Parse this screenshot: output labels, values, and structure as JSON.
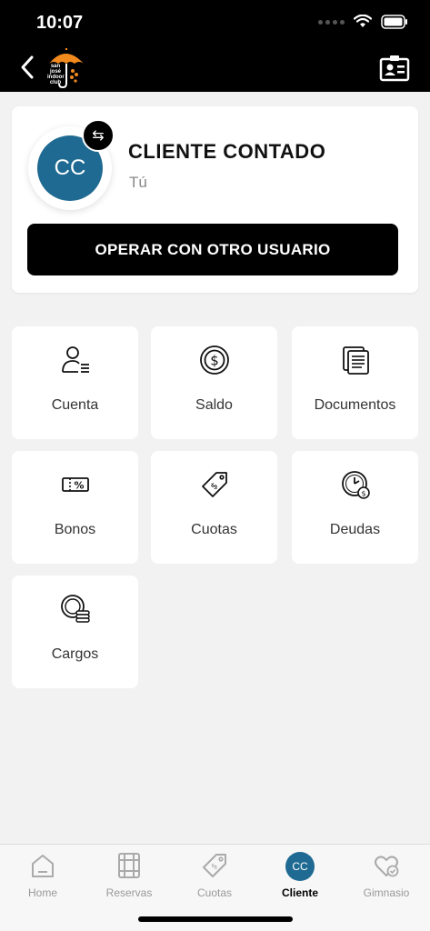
{
  "status": {
    "time": "10:07"
  },
  "header": {
    "logo_lines": [
      "san",
      "josé",
      "indoor",
      "club"
    ],
    "colors": {
      "brand_orange": "#f28a1e",
      "bar": "#000000"
    }
  },
  "profile": {
    "initials": "CC",
    "name": "CLIENTE CONTADO",
    "subtitle": "Tú",
    "switch_icon": "⇆",
    "operate_label": "OPERAR CON OTRO USUARIO",
    "avatar_color": "#1f6a92"
  },
  "tiles": [
    {
      "label": "Cuenta",
      "icon": "user-list-icon"
    },
    {
      "label": "Saldo",
      "icon": "coin-dollar-icon"
    },
    {
      "label": "Documentos",
      "icon": "documents-icon"
    },
    {
      "label": "Bonos",
      "icon": "ticket-percent-icon"
    },
    {
      "label": "Cuotas",
      "icon": "price-tag-icon"
    },
    {
      "label": "Deudas",
      "icon": "clock-debt-icon"
    },
    {
      "label": "Cargos",
      "icon": "coins-stack-icon"
    }
  ],
  "tabbar": {
    "items": [
      {
        "label": "Home",
        "icon": "home-icon",
        "active": false
      },
      {
        "label": "Reservas",
        "icon": "calendar-grid-icon",
        "active": false
      },
      {
        "label": "Cuotas",
        "icon": "price-tag-icon",
        "active": false
      },
      {
        "label": "Cliente",
        "icon": "avatar",
        "initials": "CC",
        "active": true
      },
      {
        "label": "Gimnasio",
        "icon": "heart-check-icon",
        "active": false
      }
    ]
  }
}
